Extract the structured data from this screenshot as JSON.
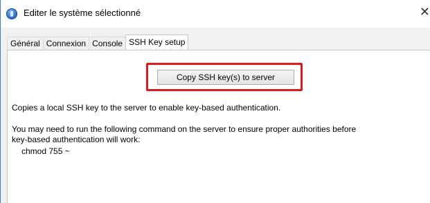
{
  "window": {
    "title": "Editer le système sélectionné",
    "close_glyph": "✕",
    "accent_color": "#3a7bd5"
  },
  "tabs": [
    {
      "label": "Général",
      "active": false
    },
    {
      "label": "Connexion",
      "active": false
    },
    {
      "label": "Console",
      "active": false
    },
    {
      "label": "SSH Key setup",
      "active": true
    }
  ],
  "panel": {
    "copy_button_label": "Copy SSH key(s) to server",
    "highlight_color": "#e0181f",
    "description": "Copies a local SSH key to the server to enable key-based authentication.",
    "note_line1": "You may need to run the following command on the server to ensure proper authorities before",
    "note_line2": "key-based authentication will work:",
    "command": "chmod 755 ~"
  }
}
